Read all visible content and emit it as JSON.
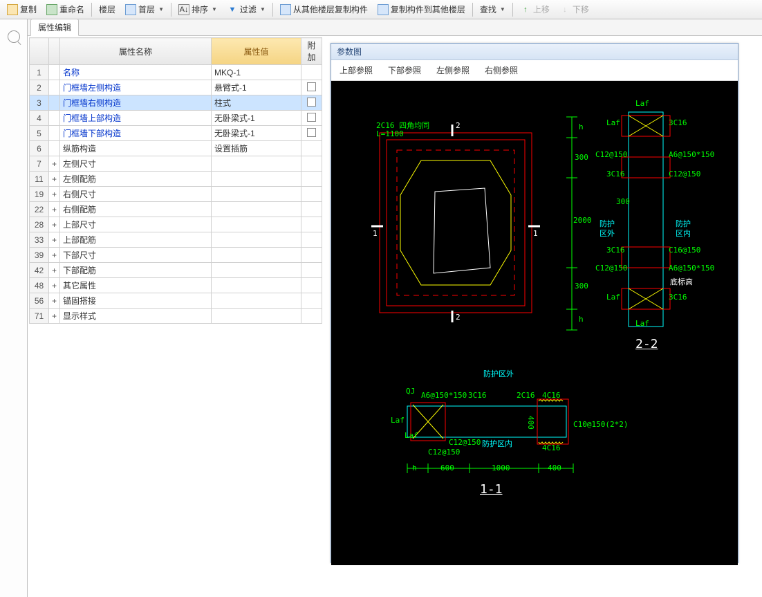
{
  "toolbar": {
    "copy": "复制",
    "rename": "重命名",
    "floor_label": "楼层",
    "floor_value": "首层",
    "sort": "排序",
    "filter": "过滤",
    "copy_from": "从其他楼层复制构件",
    "copy_to": "复制构件到其他楼层",
    "find": "查找",
    "move_up": "上移",
    "move_down": "下移"
  },
  "tab": {
    "title": "属性编辑"
  },
  "prop_headers": {
    "name": "属性名称",
    "value": "属性值",
    "extra": "附加"
  },
  "rows": [
    {
      "num": "1",
      "exp": "",
      "name": "名称",
      "plain": false,
      "value": "MKQ-1",
      "chk": false
    },
    {
      "num": "2",
      "exp": "",
      "name": "门框墙左侧构造",
      "plain": false,
      "value": "悬臂式-1",
      "chk": true
    },
    {
      "num": "3",
      "exp": "",
      "name": "门框墙右侧构造",
      "plain": false,
      "value": "柱式",
      "chk": true,
      "selected": true
    },
    {
      "num": "4",
      "exp": "",
      "name": "门框墙上部构造",
      "plain": false,
      "value": "无卧梁式-1",
      "chk": true
    },
    {
      "num": "5",
      "exp": "",
      "name": "门框墙下部构造",
      "plain": false,
      "value": "无卧梁式-1",
      "chk": true
    },
    {
      "num": "6",
      "exp": "",
      "name": "纵筋构造",
      "plain": true,
      "value": "设置插筋",
      "chk": false
    },
    {
      "num": "7",
      "exp": "+",
      "name": "左侧尺寸",
      "plain": true,
      "value": "",
      "chk": false
    },
    {
      "num": "11",
      "exp": "+",
      "name": "左侧配筋",
      "plain": true,
      "value": "",
      "chk": false
    },
    {
      "num": "19",
      "exp": "+",
      "name": "右侧尺寸",
      "plain": true,
      "value": "",
      "chk": false
    },
    {
      "num": "22",
      "exp": "+",
      "name": "右侧配筋",
      "plain": true,
      "value": "",
      "chk": false
    },
    {
      "num": "28",
      "exp": "+",
      "name": "上部尺寸",
      "plain": true,
      "value": "",
      "chk": false
    },
    {
      "num": "33",
      "exp": "+",
      "name": "上部配筋",
      "plain": true,
      "value": "",
      "chk": false
    },
    {
      "num": "39",
      "exp": "+",
      "name": "下部尺寸",
      "plain": true,
      "value": "",
      "chk": false
    },
    {
      "num": "42",
      "exp": "+",
      "name": "下部配筋",
      "plain": true,
      "value": "",
      "chk": false
    },
    {
      "num": "48",
      "exp": "+",
      "name": "其它属性",
      "plain": true,
      "value": "",
      "chk": false
    },
    {
      "num": "56",
      "exp": "+",
      "name": "锚固搭接",
      "plain": true,
      "value": "",
      "chk": false
    },
    {
      "num": "71",
      "exp": "+",
      "name": "显示样式",
      "plain": true,
      "value": "",
      "chk": false
    }
  ],
  "diagram": {
    "title": "参数图",
    "tabs": [
      "上部参照",
      "下部参照",
      "左侧参照",
      "右侧参照"
    ]
  },
  "cad": {
    "title_top1": "2C16 四角均同",
    "title_top2": "L=1100",
    "mark2_top": "2",
    "mark2_bot": "2",
    "mark1_left": "1",
    "mark1_right": "1",
    "dim_h1": "h",
    "dim_h2": "h",
    "dim_300a": "300",
    "dim_2000": "2000",
    "dim_300b": "300",
    "rt_laf1": "Laf",
    "rt_laf2": "Laf",
    "rt_laf3": "Laf",
    "rt_laf4": "Laf",
    "rt_3c16a": "3C16",
    "rt_3c16b": "3C16",
    "rt_3c16c": "3C16",
    "rt_3c16d": "3C16",
    "rt_c12a": "C12@150",
    "rt_c12b": "C12@150",
    "rt_c12c": "C12@150",
    "rt_a6a": "A6@150*150",
    "rt_a6b": "A6@150*150",
    "rt_c16": "C16@150",
    "rt_300": "300",
    "rt_out": "防护",
    "rt_out2": "区外",
    "rt_in": "防护",
    "rt_in2": "区内",
    "rt_bottom": "底标高",
    "sec22": "2-2",
    "bot_out": "防护区外",
    "bot_in": "防护区内",
    "bot_qj": "QJ",
    "bot_a6": "A6@150*150",
    "bot_3c16": "3C16",
    "bot_2c16": "2C16",
    "bot_4c16a": "4C16",
    "bot_4c16b": "4C16",
    "bot_laf1": "Laf",
    "bot_laf2": "Laf",
    "bot_c12a": "C12@150",
    "bot_c12b": "C12@150",
    "bot_c10": "C10@150(2*2)",
    "bot_400a": "400",
    "bot_400b": "400",
    "bot_h": "h",
    "bot_600": "600",
    "bot_1000": "1000",
    "sec11": "1-1"
  }
}
